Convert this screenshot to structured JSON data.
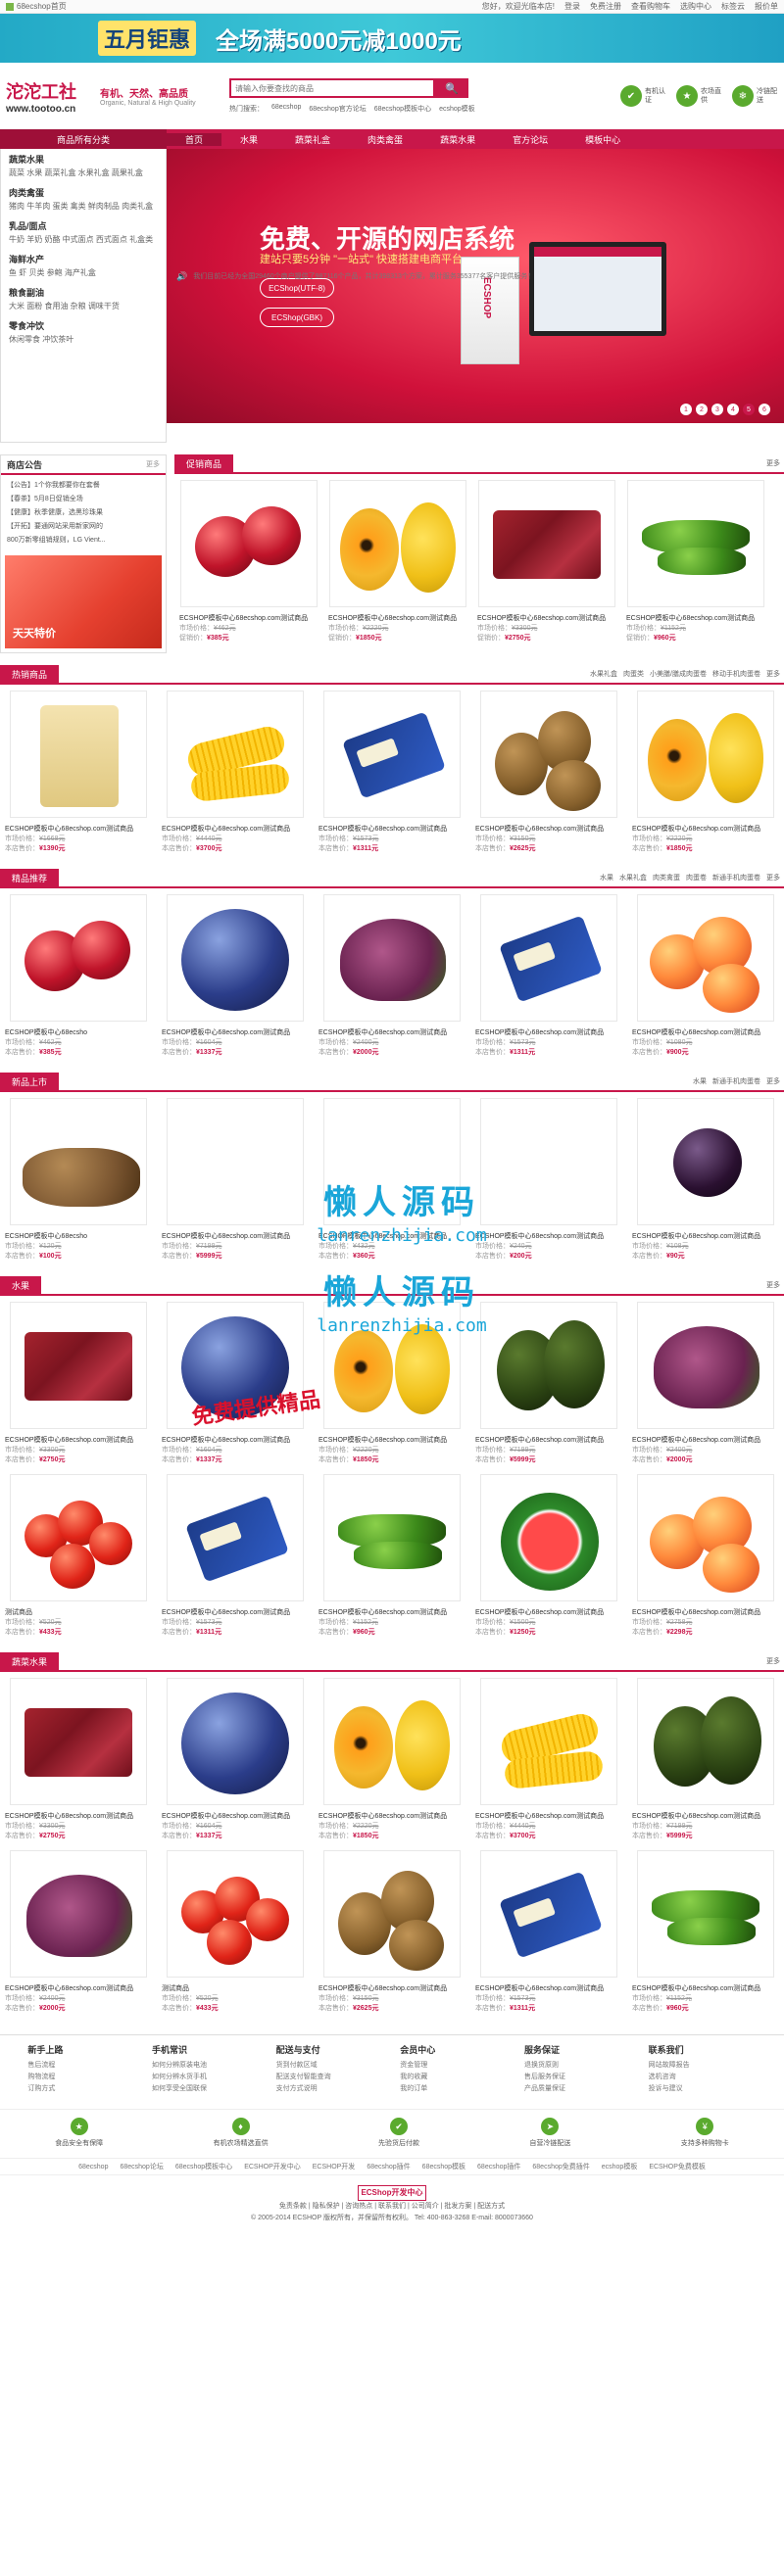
{
  "topbar": {
    "home": "68ecshop首页",
    "links": [
      "您好，欢迎光临本店!",
      "登录",
      "免费注册",
      "查看购物车",
      "选购中心",
      "标签云",
      "报价单"
    ]
  },
  "promo": {
    "tag": "五月钜惠",
    "slogan": "全场满5000元减1000元"
  },
  "logo": {
    "name": "沱沱工社",
    "url": "www.tootoo.cn"
  },
  "slogan": {
    "main": "有机、天然、高品质",
    "sub": "Organic, Natural & High Quality"
  },
  "search": {
    "placeholder": "请输入你要查找的商品",
    "button": "🔍",
    "hot_label": "热门搜索：",
    "hot": [
      "68ecshop",
      "68ecshop官方论坛",
      "68ecshop模板中心",
      "ecshop模板"
    ]
  },
  "badges": [
    {
      "icon": "✔",
      "text": "有机认证"
    },
    {
      "icon": "★",
      "text": "农场直供"
    },
    {
      "icon": "❄",
      "text": "冷链配送"
    }
  ],
  "nav": {
    "cat_head": "商品所有分类",
    "items": [
      "首页",
      "水果",
      "蔬菜礼盒",
      "肉类禽蛋",
      "蔬菜水果",
      "官方论坛",
      "模板中心"
    ]
  },
  "sidebar": [
    {
      "title": "蔬菜水果",
      "items": "蔬菜 水果 蔬菜礼盒 水果礼盒 蔬果礼盒"
    },
    {
      "title": "肉类禽蛋",
      "items": "猪肉 牛羊肉 蛋类 禽类 鲜肉制品 肉类礼盒"
    },
    {
      "title": "乳品/面点",
      "items": "牛奶 羊奶 奶酪 中式面点 西式面点 礼盒类"
    },
    {
      "title": "海鲜水产",
      "items": "鱼 虾 贝类 参鲍 海产礼盒"
    },
    {
      "title": "粮食副油",
      "items": "大米 面粉 食用油 杂粮 调味干货"
    },
    {
      "title": "零食冲饮",
      "items": "休闲零食 冲饮茶叶"
    }
  ],
  "slider": {
    "headline": "免费、开源的网店系统",
    "sub": "建站只要5分钟 \"一站式\" 快速搭建电商平台",
    "btn1": "ECShop(UTF-8)",
    "btn2": "ECShop(GBK)",
    "boxname": "ECSHOP",
    "dots": [
      "1",
      "2",
      "3",
      "4",
      "5",
      "6"
    ]
  },
  "ticker": "我们目前已经为全国29460个商户提供了987116个产品，共计398313个方案，累计服务355377名客户提供服务！",
  "notice": {
    "title": "商店公告",
    "more": "更多",
    "items": [
      "【公告】1个你我都要你在套餐",
      "【春茶】5月8日促销全场",
      "【健康】秋季健康，选黑珍珠果",
      "【开拓】要通网站采用新家网的",
      "800万新零组销规则，LG Vient..."
    ],
    "promo": "天天特价"
  },
  "more": "更多",
  "sections": [
    {
      "title": "促销商品",
      "links": [],
      "products": [
        {
          "art": "apple",
          "name": "ECSHOP模板中心68ecshop.com测试商品",
          "market": "¥462元",
          "price": "¥385元"
        },
        {
          "art": "papaya",
          "name": "ECSHOP模板中心68ecshop.com测试商品",
          "market": "¥2220元",
          "price": "¥1850元"
        },
        {
          "art": "meat",
          "name": "ECSHOP模板中心68ecshop.com测试商品",
          "market": "¥3300元",
          "price": "¥2750元"
        },
        {
          "art": "pepper",
          "name": "ECSHOP模板中心68ecshop.com测试商品",
          "market": "¥1152元",
          "price": "¥960元"
        }
      ]
    },
    {
      "title": "热销商品",
      "links": [
        "水果礼盒",
        "肉蛋类",
        "小美膳/膳成肉蛋卷",
        "移动手机肉蛋卷"
      ],
      "products": [
        {
          "art": "bag",
          "name": "ECSHOP模板中心68ecshop.com测试商品",
          "market": "¥1668元",
          "price": "¥1390元"
        },
        {
          "art": "corn",
          "name": "ECSHOP模板中心68ecshop.com测试商品",
          "market": "¥4440元",
          "price": "¥3700元"
        },
        {
          "art": "cheese",
          "name": "ECSHOP模板中心68ecshop.com测试商品",
          "market": "¥1573元",
          "price": "¥1311元"
        },
        {
          "art": "kiwi",
          "name": "ECSHOP模板中心68ecshop.com测试商品",
          "market": "¥3150元",
          "price": "¥2625元"
        },
        {
          "art": "papaya",
          "name": "ECSHOP模板中心68ecshop.com测试商品",
          "market": "¥2220元",
          "price": "¥1850元"
        }
      ]
    },
    {
      "title": "精品推荐",
      "links": [
        "水果",
        "水果礼盒",
        "肉类禽蛋",
        "肉蛋卷",
        "新通手机肉蛋卷"
      ],
      "products": [
        {
          "art": "apple",
          "name": "ECSHOP模板中心68ecsho",
          "market": "¥462元",
          "price": "¥385元"
        },
        {
          "art": "blueberry",
          "name": "ECSHOP模板中心68ecshop.com测试商品",
          "market": "¥1604元",
          "price": "¥1337元"
        },
        {
          "art": "leaf",
          "name": "ECSHOP模板中心68ecshop.com测试商品",
          "market": "¥2400元",
          "price": "¥2000元"
        },
        {
          "art": "cheese",
          "name": "ECSHOP模板中心68ecshop.com测试商品",
          "market": "¥1573元",
          "price": "¥1311元"
        },
        {
          "art": "apricot",
          "name": "ECSHOP模板中心68ecshop.com测试商品",
          "market": "¥1080元",
          "price": "¥900元"
        }
      ]
    },
    {
      "title": "新品上市",
      "links": [
        "水果",
        "新通手机肉蛋卷"
      ],
      "products": [
        {
          "art": "bean",
          "name": "ECSHOP模板中心68ecsho",
          "market": "¥120元",
          "price": "¥100元"
        },
        {
          "art": "blank",
          "name": "ECSHOP模板中心68ecshop.com测试商品",
          "market": "¥7199元",
          "price": "¥5999元"
        },
        {
          "art": "blank",
          "name": "ECSHOP模板中心68ecshop.com测试商品",
          "market": "¥432元",
          "price": "¥360元"
        },
        {
          "art": "blank",
          "name": "ECSHOP模板中心68ecshop.com测试商品",
          "market": "¥240元",
          "price": "¥200元"
        },
        {
          "art": "plum",
          "name": "ECSHOP模板中心68ecshop.com测试商品",
          "market": "¥108元",
          "price": "¥90元"
        }
      ]
    },
    {
      "title": "水果",
      "links": [],
      "products": [
        {
          "art": "meat",
          "name": "ECSHOP模板中心68ecshop.com测试商品",
          "market": "¥3300元",
          "price": "¥2750元"
        },
        {
          "art": "blueberry",
          "name": "ECSHOP模板中心68ecshop.com测试商品",
          "market": "¥1604元",
          "price": "¥1337元"
        },
        {
          "art": "papaya",
          "name": "ECSHOP模板中心68ecshop.com测试商品",
          "market": "¥2220元",
          "price": "¥1850元"
        },
        {
          "art": "avocado",
          "name": "ECSHOP模板中心68ecshop.com测试商品",
          "market": "¥7199元",
          "price": "¥5999元"
        },
        {
          "art": "leaf",
          "name": "ECSHOP模板中心68ecshop.com测试商品",
          "market": "¥2400元",
          "price": "¥2000元"
        },
        {
          "art": "tomato",
          "name": "测试商品",
          "market": "¥520元",
          "price": "¥433元"
        },
        {
          "art": "cheese",
          "name": "ECSHOP模板中心68ecshop.com测试商品",
          "market": "¥1573元",
          "price": "¥1311元"
        },
        {
          "art": "pepper",
          "name": "ECSHOP模板中心68ecshop.com测试商品",
          "market": "¥1152元",
          "price": "¥960元"
        },
        {
          "art": "melon",
          "name": "ECSHOP模板中心68ecshop.com测试商品",
          "market": "¥1500元",
          "price": "¥1250元"
        },
        {
          "art": "apricot",
          "name": "ECSHOP模板中心68ecshop.com测试商品",
          "market": "¥2758元",
          "price": "¥2298元"
        }
      ]
    },
    {
      "title": "蔬菜水果",
      "links": [],
      "products": [
        {
          "art": "meat",
          "name": "ECSHOP模板中心68ecshop.com测试商品",
          "market": "¥3300元",
          "price": "¥2750元"
        },
        {
          "art": "blueberry",
          "name": "ECSHOP模板中心68ecshop.com测试商品",
          "market": "¥1604元",
          "price": "¥1337元"
        },
        {
          "art": "papaya",
          "name": "ECSHOP模板中心68ecshop.com测试商品",
          "market": "¥2220元",
          "price": "¥1850元"
        },
        {
          "art": "corn",
          "name": "ECSHOP模板中心68ecshop.com测试商品",
          "market": "¥4440元",
          "price": "¥3700元"
        },
        {
          "art": "avocado",
          "name": "ECSHOP模板中心68ecshop.com测试商品",
          "market": "¥7199元",
          "price": "¥5999元"
        },
        {
          "art": "leaf",
          "name": "ECSHOP模板中心68ecshop.com测试商品",
          "market": "¥2400元",
          "price": "¥2000元"
        },
        {
          "art": "tomato",
          "name": "测试商品",
          "market": "¥520元",
          "price": "¥433元"
        },
        {
          "art": "kiwi",
          "name": "ECSHOP模板中心68ecshop.com测试商品",
          "market": "¥3150元",
          "price": "¥2625元"
        },
        {
          "art": "cheese",
          "name": "ECSHOP模板中心68ecshop.com测试商品",
          "market": "¥1573元",
          "price": "¥1311元"
        },
        {
          "art": "pepper",
          "name": "ECSHOP模板中心68ecshop.com测试商品",
          "market": "¥1152元",
          "price": "¥960元"
        }
      ]
    }
  ],
  "labels": {
    "market": "市场价格：",
    "shop": "本店售价：",
    "promo": "促销价："
  },
  "watermark": {
    "w1": "懒人源码",
    "w2": "lanrenzhijia.com",
    "w3": "懒人源码",
    "w4": "lanrenzhijia.com",
    "w5": "免费提供精品"
  },
  "footer": {
    "cols": [
      {
        "title": "新手上路",
        "items": [
          "售后流程",
          "购物流程",
          "订购方式"
        ]
      },
      {
        "title": "手机常识",
        "items": [
          "如何分辨原装电池",
          "如何分辨水货手机",
          "如何享受全国联保"
        ]
      },
      {
        "title": "配送与支付",
        "items": [
          "货到付款区域",
          "配送支付智能查询",
          "支付方式说明"
        ]
      },
      {
        "title": "会员中心",
        "items": [
          "资金管理",
          "我的收藏",
          "我的订单"
        ]
      },
      {
        "title": "服务保证",
        "items": [
          "退换货原则",
          "售后服务保证",
          "产品质量保证"
        ]
      },
      {
        "title": "联系我们",
        "items": [
          "网站故障报告",
          "选机咨询",
          "投诉与建议"
        ]
      }
    ],
    "services": [
      {
        "icon": "★",
        "text": "食品安全有保障"
      },
      {
        "icon": "♦",
        "text": "有机农场精选直供"
      },
      {
        "icon": "✔",
        "text": "先验货后付款"
      },
      {
        "icon": "➤",
        "text": "自营冷链配送"
      },
      {
        "icon": "¥",
        "text": "支持多种购物卡"
      }
    ],
    "links": [
      "68ecshop",
      "68ecshop论坛",
      "68ecshop模板中心",
      "ECSHOP开发中心",
      "ECSHOP开发",
      "68ecshop插件",
      "68ecshop模板",
      "68ecshop插件",
      "68ecshop免费插件",
      "ecshop模板",
      "ECSHOP免费模板"
    ],
    "logo_text": "ECShop开发中心",
    "nav": "免责条款 | 隐私保护 | 咨询热点 | 联系我们 | 公司简介 | 批发方案 | 配送方式",
    "copyright": "© 2005-2014 ECSHOP 版权所有，并保留所有权利。 Tel: 400-863-3268 E-mail: 8000073660"
  }
}
